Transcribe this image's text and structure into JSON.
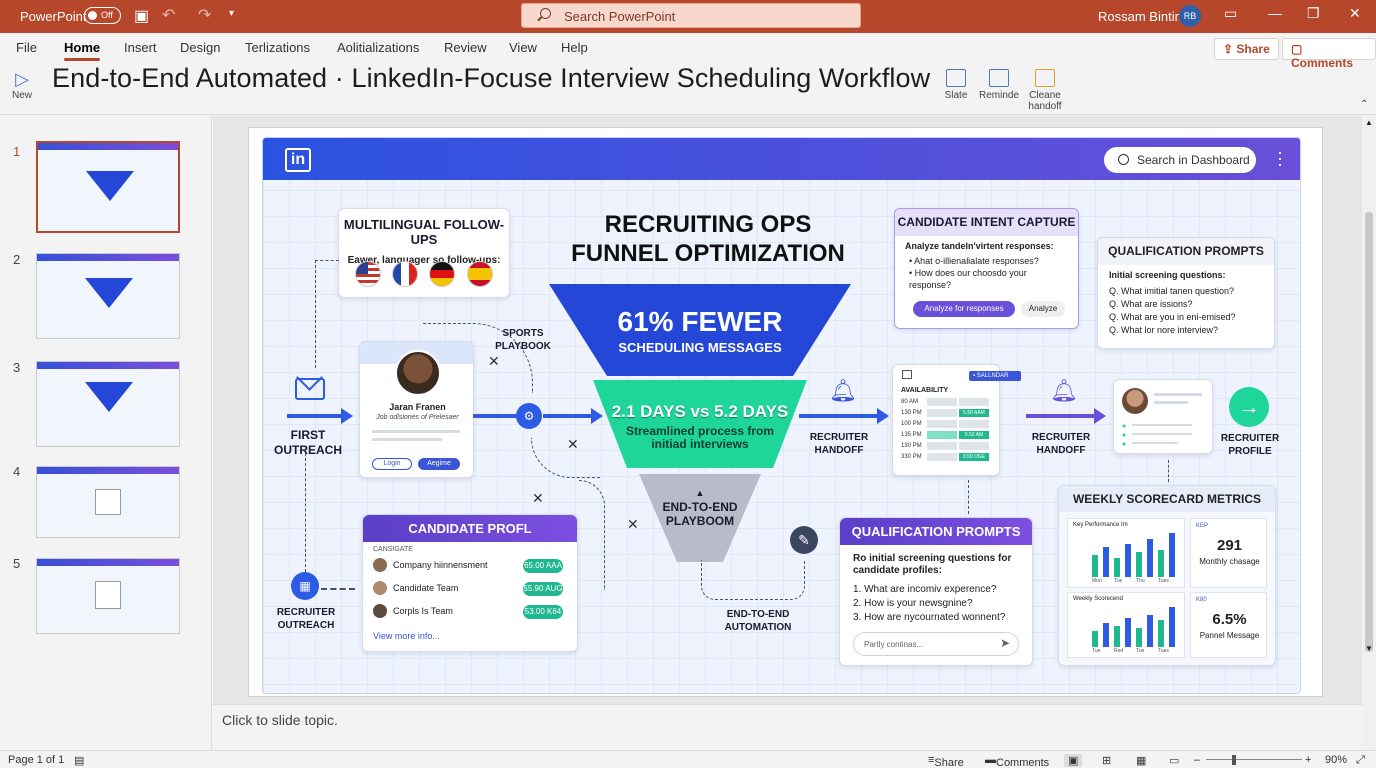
{
  "titlebar": {
    "app": "PowerPoint",
    "autosave": "Off",
    "search_placeholder": "Search PowerPoint",
    "user": "Rossam Bintin",
    "avatar_initials": "RB"
  },
  "ribbon": {
    "tabs": [
      "File",
      "Home",
      "Insert",
      "Design",
      "Terlizations",
      "Aolitializations",
      "Review",
      "View",
      "Help"
    ],
    "active_tab": "Home",
    "share": "Share",
    "comments": "Comments",
    "new_label": "New",
    "slide_title": "End-to-End Automated · LinkedIn-Focuse Interview Scheduling Workflow",
    "tools": [
      "Slate",
      "Reminde",
      "Cleane handoff"
    ]
  },
  "thumbnails": {
    "numbers": [
      "1",
      "2",
      "3",
      "4",
      "5"
    ],
    "selected": "1"
  },
  "slide": {
    "search": "Search in Dashboard",
    "funnel": {
      "title": "RECRUITING OPS FUNNEL OPTIMIZATION",
      "top_big": "61% FEWER",
      "top_small": "SCHEDULING MESSAGES",
      "mid_big": "2.1 DAYS vs 5.2 DAYS",
      "mid_small": "Streamlined process from initiad interviews",
      "bottom": "END-TO-END PLAYBOOM"
    },
    "multilingual": {
      "title": "MULTILINGUAL FOLLOW-UPS",
      "subtitle": "Eawer, languager so follow-ups:"
    },
    "sports": "SPORTS PLAYBOOK",
    "profile": {
      "name": "Jaran Franen",
      "role": "Job odlsiones of Prelesaer",
      "login": "Login",
      "register": "Aegime"
    },
    "first_outreach": "FIRST OUTREACH",
    "recruiter_outreach": "RECRUITER OUTREACH",
    "candidate_profile": {
      "title": "CANDIDATE PROFL",
      "header": "CANSIGATE",
      "rows": [
        {
          "label": "Company hiinnensment",
          "value": "65.00 AAA"
        },
        {
          "label": "Candidate Team",
          "value": "55.90 AUG"
        },
        {
          "label": "Corpls Is Team",
          "value": "53.00 K64"
        }
      ],
      "link": "View more info..."
    },
    "intent": {
      "title": "CANDIDATE INTENT CAPTURE",
      "heading": "Analyze tandeln'virtent responses:",
      "bullets": [
        "Ahat o-illienalialate responses?",
        "How does our choosdo your response?"
      ],
      "btn_primary": "Analyze for responses",
      "btn_secondary": "Analyze"
    },
    "qual_top": {
      "title": "QUALIFICATION PROMPTS",
      "heading": "Initial screening questions:",
      "items": [
        "Q.  What imitial tanen question?",
        "Q.  What are issions?",
        "Q.  What are you in eni-emised?",
        "Q.  What lor nore interview?"
      ]
    },
    "recruiter_handoff_left": "RECRUITER HANDOFF",
    "recruiter_handoff_right": "RECRUITER HANDOFF",
    "recruiter_profile": "RECRUITER PROFILE",
    "calendar": {
      "label": "AVAILABILITY",
      "button": "SALLNDAR",
      "times": [
        "80 AM",
        "130 PM",
        "100 PM",
        "135 PM",
        "130 PM",
        "330 PM"
      ],
      "slots": [
        "",
        "5.50 AAM",
        "",
        "5.50 AM",
        "",
        "3.50 OGE"
      ]
    },
    "end_to_end": "END-TO-END AUTOMATION",
    "qual_bottom": {
      "title": "QUALIFICATION PROMPTS",
      "heading": "Ro initial screening questions for candidate profiles:",
      "items": [
        "1. What are incomiv experence?",
        "2. How is your newsgnine?",
        "3. How are nycournated wonnent?"
      ],
      "placeholder": "Partly continas..."
    },
    "weekly": {
      "title": "WEEKLY SCORECARD METRICS",
      "chart1_label": "Key Performance Im",
      "chart2_label": "Weekly Scorecend",
      "chart1_ticks": [
        "Mon",
        "Tue",
        "Thu",
        "Tues"
      ],
      "chart2_ticks": [
        "Tue",
        "Red",
        "Tue",
        "Tues"
      ],
      "kpi1_label": "KEP",
      "kpi1_value": "291",
      "kpi1_desc": "Monthly chasage",
      "kpi2_label": "K80",
      "kpi2_value": "6.5%",
      "kpi2_desc": "Pannel Message",
      "chart1_values": [
        40,
        55,
        35,
        60,
        45,
        70,
        50,
        80
      ],
      "chart2_values": [
        30,
        45,
        40,
        55,
        35,
        60,
        50,
        75
      ]
    }
  },
  "notes": "Click to slide topic.",
  "status": {
    "page": "Page 1 of 1",
    "share": "Share",
    "comments": "Comments",
    "zoom": "90%"
  },
  "colors": {
    "accent": "#b7472a",
    "funnel_top": "#2447d8",
    "funnel_mid": "#1ed69a",
    "funnel_bottom": "#b8bcc8",
    "purple": "#6a4fd8"
  }
}
